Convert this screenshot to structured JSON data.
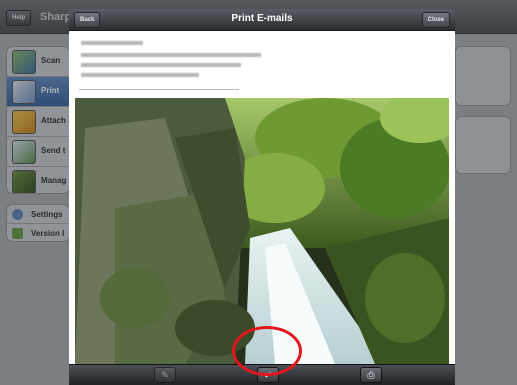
{
  "background_app": {
    "help_label": "Help",
    "app_title": "Sharp",
    "sidebar": {
      "items": [
        {
          "label": "Scan",
          "icon": "scan-icon"
        },
        {
          "label": "Print",
          "icon": "print-icon",
          "active": true
        },
        {
          "label": "Attach",
          "icon": "attach-icon"
        },
        {
          "label": "Send t",
          "icon": "send-icon"
        },
        {
          "label": "Manag",
          "icon": "manage-icon"
        }
      ],
      "settings_items": [
        {
          "label": "Settings",
          "icon": "gear-icon"
        },
        {
          "label": "Version I",
          "icon": "info-icon"
        }
      ]
    }
  },
  "modal": {
    "title": "Print E-mails",
    "back_label": "Back",
    "close_label": "Close"
  },
  "toolbar": {
    "edit_icon": "edit-icon",
    "confirm_icon": "checkmark-icon",
    "print_icon": "printer-icon"
  },
  "colors": {
    "active_blue": "#4a72ad",
    "highlight_red": "#e2161b",
    "toolbar_dark": "#2a2d31"
  }
}
